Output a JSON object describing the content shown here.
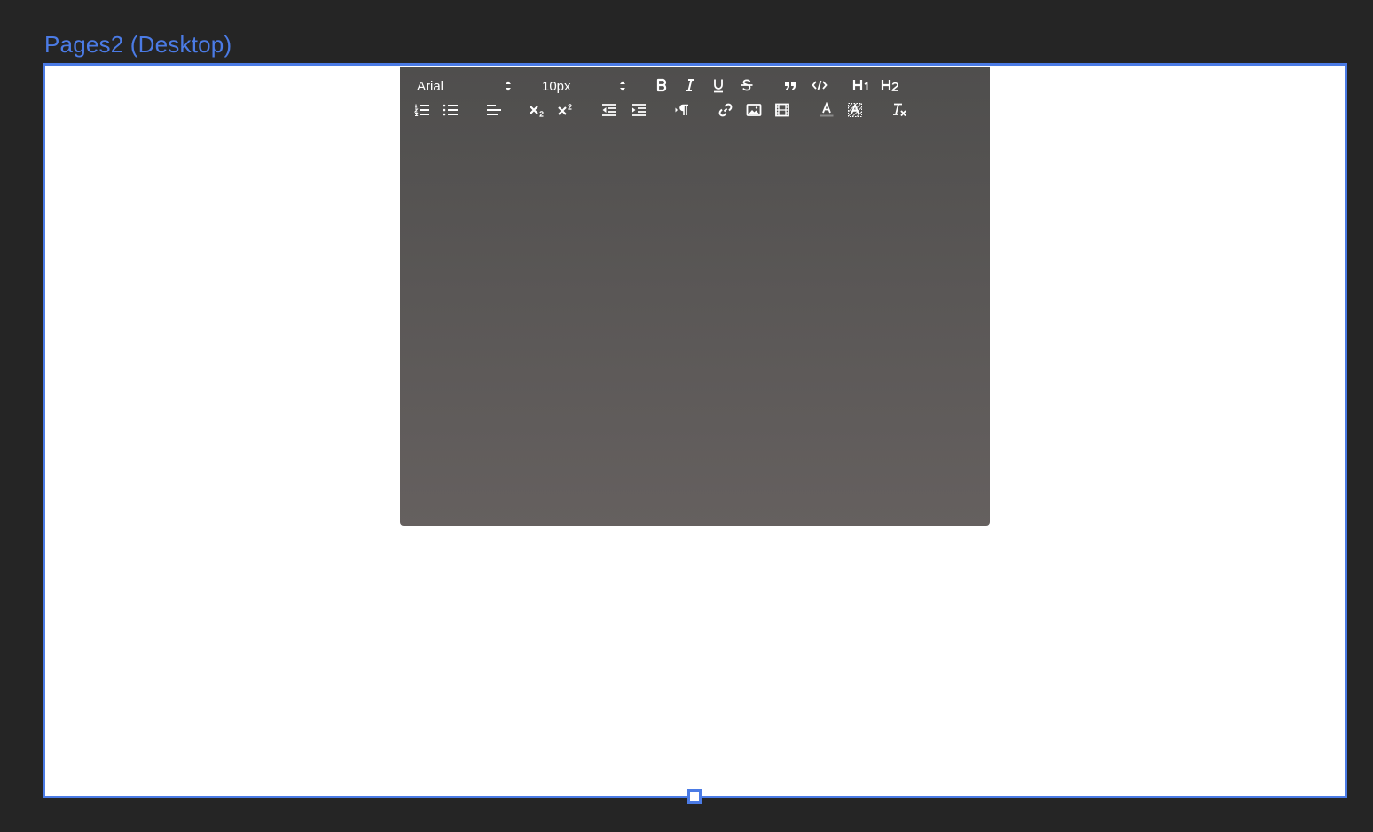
{
  "canvas": {
    "frame_title": "Pages2 (Desktop)",
    "accent_color": "#4b7be5",
    "background_color": "#252525"
  },
  "editor": {
    "font_family_select": {
      "value": "Arial"
    },
    "font_size_select": {
      "value": "10px"
    },
    "toolbar_row1": [
      "bold-icon",
      "italic-icon",
      "underline-icon",
      "strikethrough-icon",
      "blockquote-icon",
      "code-icon",
      "heading1-icon",
      "heading2-icon"
    ],
    "toolbar_row2": [
      "ordered-list-icon",
      "bullet-list-icon",
      "align-left-icon",
      "subscript-icon",
      "superscript-icon",
      "outdent-icon",
      "indent-icon",
      "text-direction-icon",
      "link-icon",
      "image-icon",
      "video-icon",
      "text-color-icon",
      "background-color-icon",
      "clear-format-icon"
    ]
  }
}
